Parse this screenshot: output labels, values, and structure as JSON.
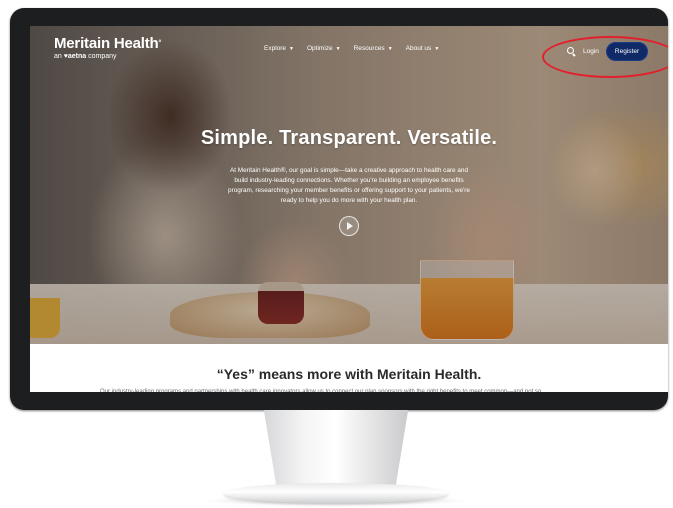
{
  "brand": {
    "name": "Meritain Health",
    "registered": "°",
    "tag_prefix": "an ",
    "tag_logo": "aetna",
    "tag_suffix": " company"
  },
  "nav": {
    "items": [
      {
        "label": "Explore"
      },
      {
        "label": "Optimize"
      },
      {
        "label": "Resources"
      },
      {
        "label": "About us"
      }
    ],
    "caret": "▼",
    "login_label": "Login",
    "register_label": "Register"
  },
  "hero": {
    "title": "Simple. Transparent. Versatile.",
    "copy": "At Meritain Health®, our goal is simple—take a creative approach to health care and build industry-leading connections. Whether you're building an employee benefits program, researching your member benefits or offering support to your patients, we're ready to help you do more with your health plan."
  },
  "section": {
    "title": "“Yes” means more with Meritain Health.",
    "text": "Our industry-leading programs and partnerships with health care innovators allow us to connect our plan sponsors with the right benefits to meet common—and not so"
  },
  "colors": {
    "register_bg": "#0f2a66",
    "highlight_ring": "#e2202c",
    "monitor_bezel": "#1d1e20"
  }
}
